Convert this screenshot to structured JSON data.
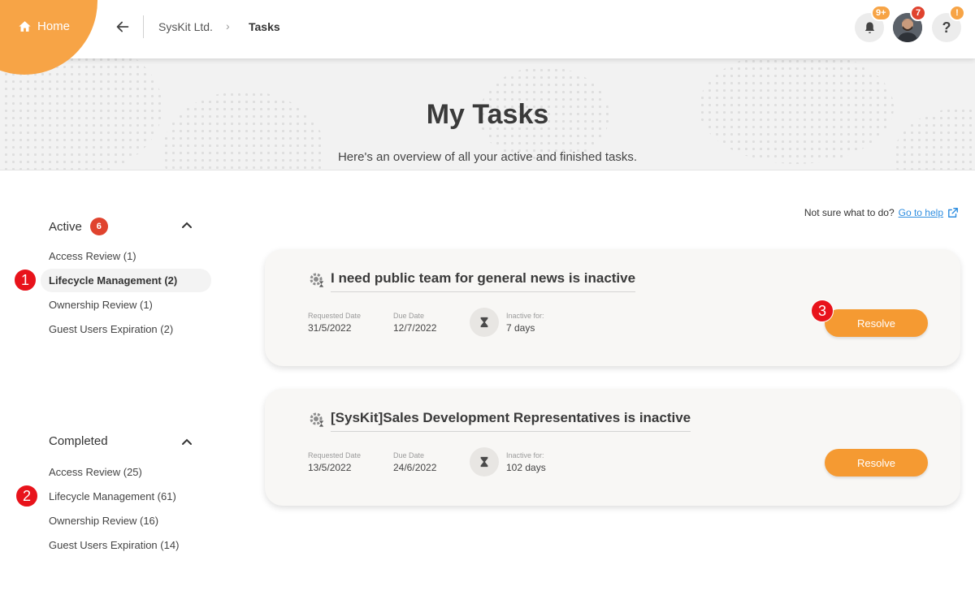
{
  "nav": {
    "home_label": "Home",
    "breadcrumb_org": "SysKit Ltd.",
    "breadcrumb_separator": "›",
    "breadcrumb_current": "Tasks"
  },
  "header_icons": {
    "notifications_badge": "9+",
    "avatar_badge": "7",
    "help_label": "?",
    "help_badge": "!"
  },
  "hero": {
    "title": "My Tasks",
    "subtitle": "Here's an overview of all your active and finished tasks."
  },
  "sidebar": {
    "active": {
      "label": "Active",
      "count": "6",
      "items": [
        {
          "label": "Access Review (1)"
        },
        {
          "label": "Lifecycle Management (2)"
        },
        {
          "label": "Ownership Review (1)"
        },
        {
          "label": "Guest Users Expiration (2)"
        }
      ]
    },
    "completed": {
      "label": "Completed",
      "items": [
        {
          "label": "Access Review (25)"
        },
        {
          "label": "Lifecycle Management (61)"
        },
        {
          "label": "Ownership Review (16)"
        },
        {
          "label": "Guest Users Expiration (14)"
        }
      ]
    }
  },
  "help": {
    "prompt": "Not sure what to do?",
    "link": "Go to help"
  },
  "tasks": [
    {
      "title": "I need public team for general news is inactive",
      "requested_label": "Requested Date",
      "requested_value": "31/5/2022",
      "due_label": "Due Date",
      "due_value": "12/7/2022",
      "inactive_label": "Inactive for:",
      "inactive_value": "7 days",
      "action": "Resolve"
    },
    {
      "title": "[SysKit]Sales Development Representatives is inactive",
      "requested_label": "Requested Date",
      "requested_value": "13/5/2022",
      "due_label": "Due Date",
      "due_value": "24/6/2022",
      "inactive_label": "Inactive for:",
      "inactive_value": "102 days",
      "action": "Resolve"
    }
  ],
  "markers": [
    "1",
    "2",
    "3"
  ],
  "colors": {
    "accent_orange": "#f59a32",
    "badge_red": "#e0432e",
    "marker_red": "#e8131b",
    "link_blue": "#2f8ee0"
  }
}
